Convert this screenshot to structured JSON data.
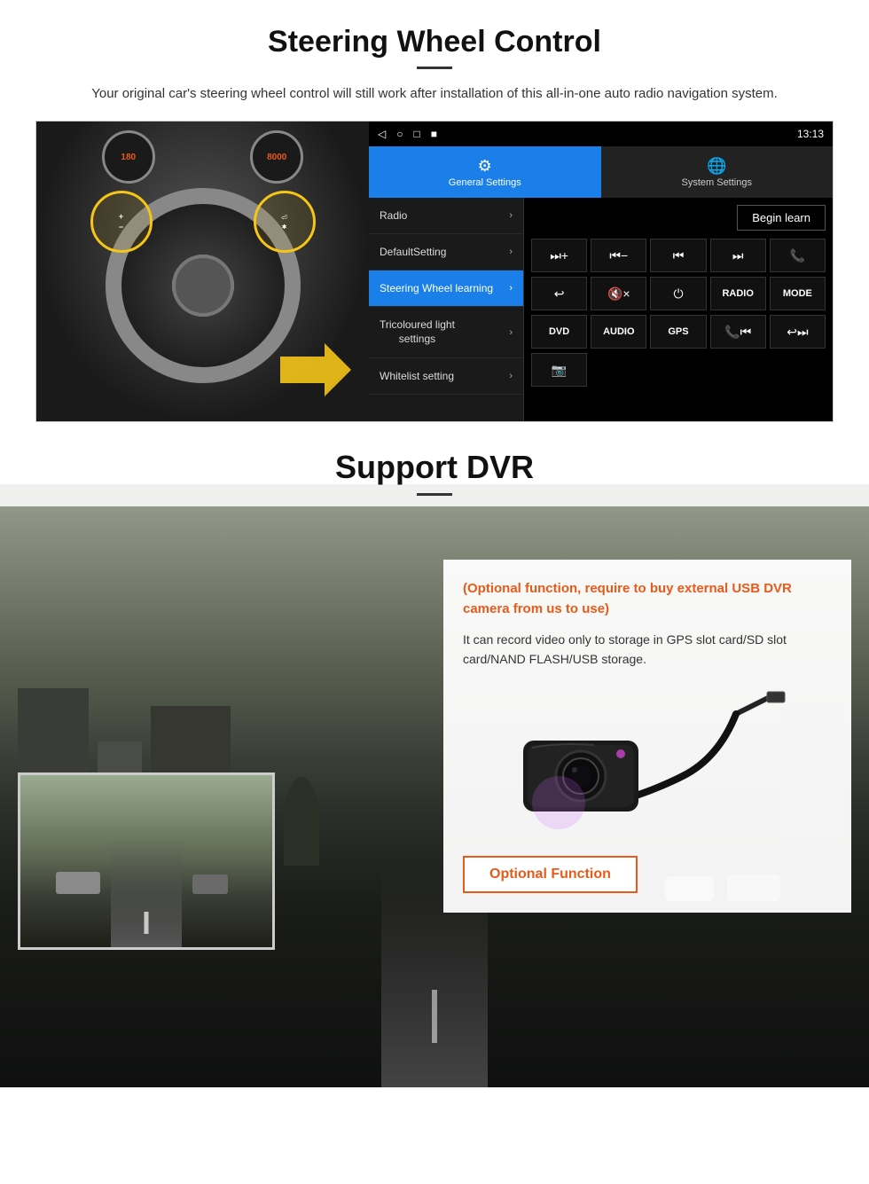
{
  "steering_section": {
    "title": "Steering Wheel Control",
    "subtitle": "Your original car's steering wheel control will still work after installation of this all-in-one auto radio navigation system.",
    "android_statusbar": {
      "time": "13:13",
      "icons": [
        "◁",
        "○",
        "□",
        "■"
      ]
    },
    "tabs": [
      {
        "label": "General Settings",
        "icon": "⚙",
        "active": true
      },
      {
        "label": "System Settings",
        "icon": "🌐",
        "active": false
      }
    ],
    "menu_items": [
      {
        "label": "Radio",
        "active": false
      },
      {
        "label": "DefaultSetting",
        "active": false
      },
      {
        "label": "Steering Wheel learning",
        "active": true
      },
      {
        "label": "Tricoloured light settings",
        "active": false
      },
      {
        "label": "Whitelist setting",
        "active": false
      }
    ],
    "begin_learn_label": "Begin learn",
    "control_buttons_row1": [
      "⏭+",
      "⏮-",
      "⏮⏮",
      "⏭⏭",
      "📞"
    ],
    "control_buttons_row2": [
      "↩",
      "🔇×",
      "⏻",
      "RADIO",
      "MODE"
    ],
    "control_buttons_row3": [
      "DVD",
      "AUDIO",
      "GPS",
      "📞⏮",
      "↩⏭⏭"
    ],
    "control_buttons_row4": [
      "📷"
    ]
  },
  "dvr_section": {
    "title": "Support DVR",
    "optional_text": "(Optional function, require to buy external USB DVR camera from us to use)",
    "desc": "It can record video only to storage in GPS slot card/SD slot card/NAND FLASH/USB storage.",
    "optional_function_label": "Optional Function"
  }
}
